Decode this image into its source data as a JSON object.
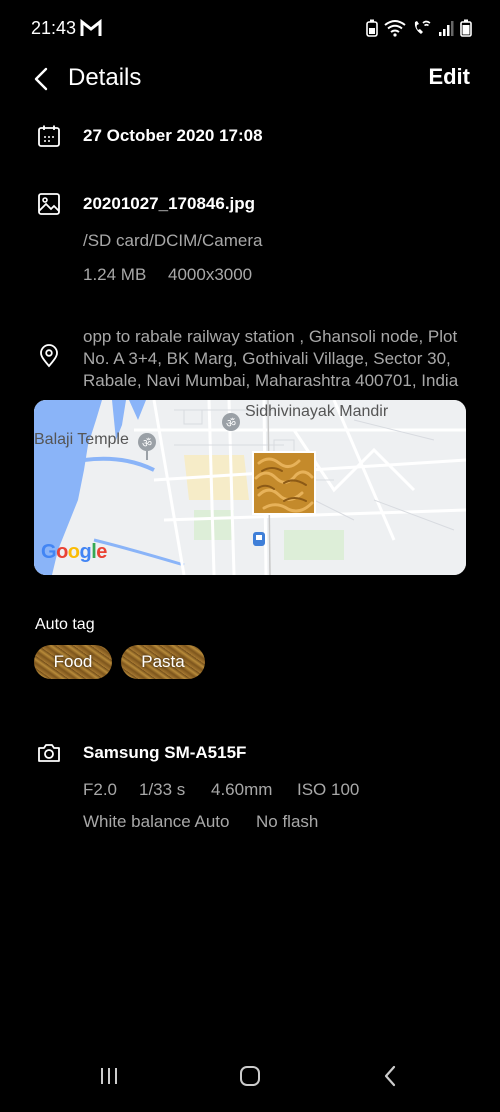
{
  "status": {
    "time": "21:43"
  },
  "header": {
    "title": "Details",
    "edit_label": "Edit"
  },
  "date_row": {
    "datetime": "27 October 2020 17:08"
  },
  "file_row": {
    "filename": "20201027_170846.jpg",
    "path": "/SD card/DCIM/Camera",
    "size": "1.24 MB",
    "resolution": "4000x3000"
  },
  "location_row": {
    "address": "opp to rabale railway station , Ghansoli node, Plot No. A 3+4, BK Marg, Gothivali Village, Sector 30, Rabale, Navi Mumbai, Maharashtra 400701, India"
  },
  "map": {
    "place_1": "Sidhivinayak Mandir",
    "place_2": "Balaji Temple",
    "attribution": "Google"
  },
  "auto_tag": {
    "label": "Auto tag",
    "tags": [
      "Food",
      "Pasta"
    ]
  },
  "camera_row": {
    "model": "Samsung SM-A515F",
    "aperture": "F2.0",
    "shutter": "1/33 s",
    "focal_length": "4.60mm",
    "iso": "ISO 100",
    "white_balance": "White balance Auto",
    "flash": "No flash"
  },
  "colors": {
    "background": "#000000",
    "text_primary": "#ffffff",
    "text_secondary": "#a8a8a8",
    "map_water": "#8ab4f8"
  }
}
